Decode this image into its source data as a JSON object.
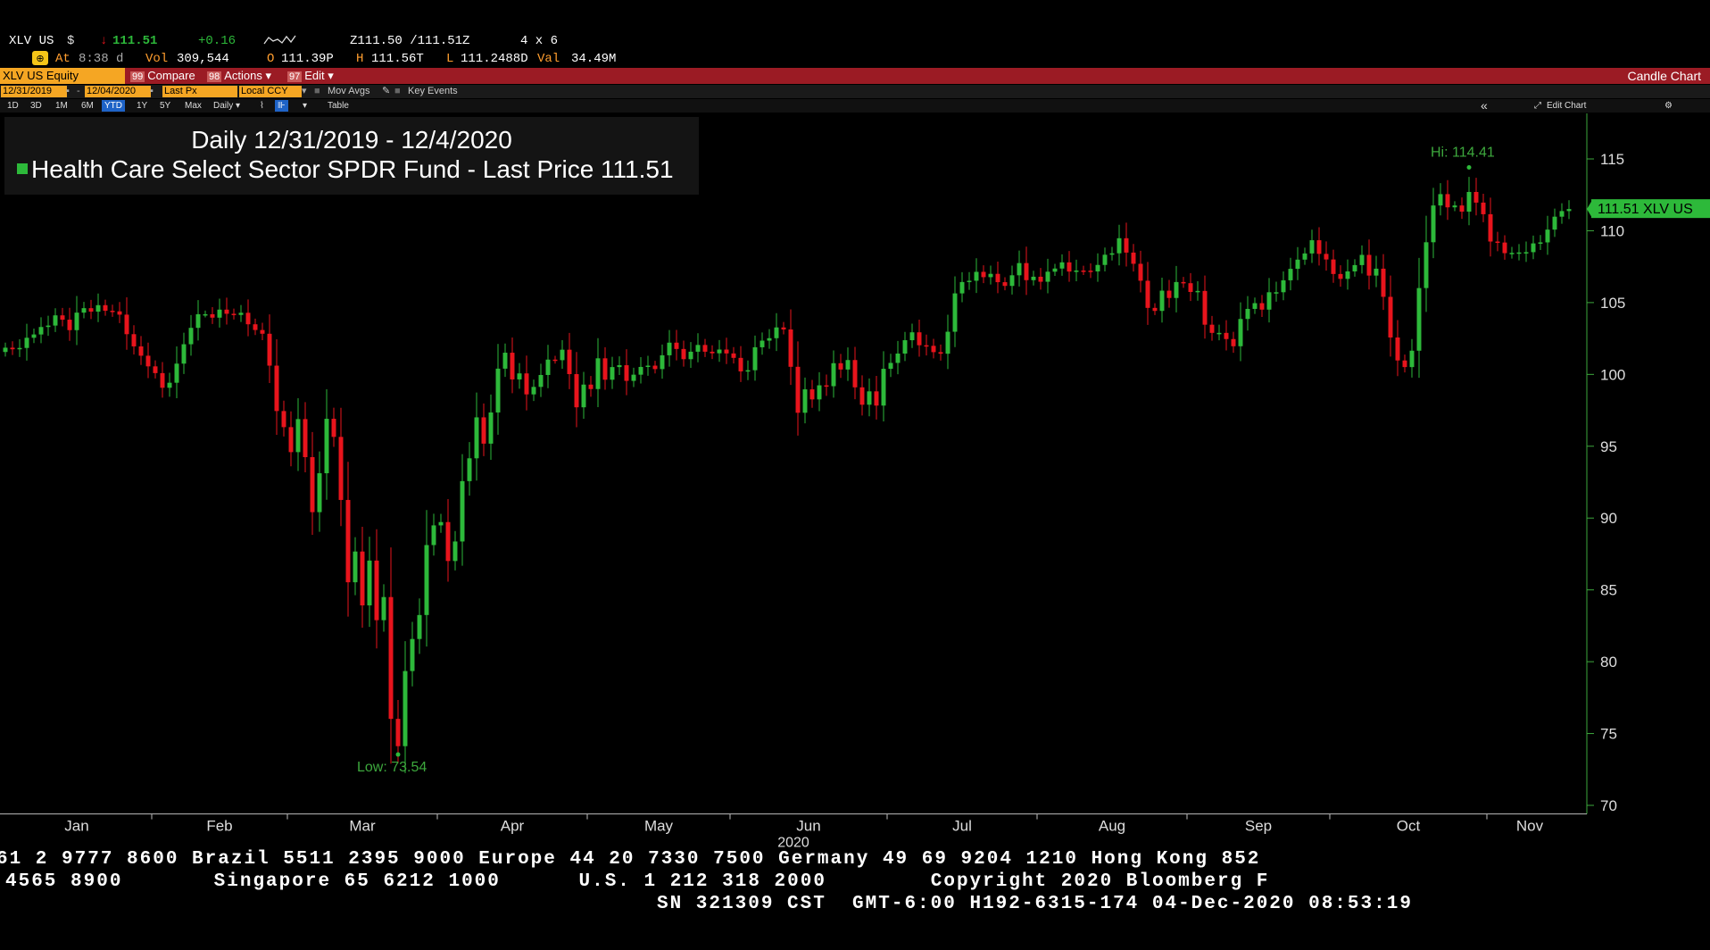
{
  "quote": {
    "ticker": "XLV US",
    "currency": "$",
    "arrow": "↓",
    "last": "111.51",
    "change": "+0.16",
    "bidask": "Z111.50 /111.51Z",
    "size": "4 x 6",
    "at_label": "At",
    "time": "8:38 d",
    "vol_label": "Vol",
    "vol": "309,544",
    "open_label": "O",
    "open": "111.39P",
    "high_label": "H",
    "high": "111.56T",
    "low_label": "L",
    "low": "111.2488D",
    "val_label": "Val",
    "val": "34.49M"
  },
  "toolbar": {
    "security": "XLV US Equity",
    "compare_num": "99",
    "compare": "Compare",
    "actions_num": "98",
    "actions": "Actions ▾",
    "edit_num": "97",
    "edit": "Edit ▾",
    "chart_type": "Candle Chart"
  },
  "datebar": {
    "start": "12/31/2019",
    "end": "12/04/2020",
    "field": "Last Px",
    "ccy": "Local CCY",
    "mov_avgs": "Mov Avgs",
    "key_events": "Key Events"
  },
  "ranges": [
    "1D",
    "3D",
    "1M",
    "6M",
    "YTD",
    "1Y",
    "5Y",
    "Max",
    "Daily ▾"
  ],
  "selected_range": "YTD",
  "table_label": "Table",
  "edit_chart": "Edit Chart",
  "legend": {
    "title": "Daily 12/31/2019 - 12/4/2020",
    "series": "Health Care Select Sector SPDR Fund - Last Price 111.51"
  },
  "colors": {
    "up": "#2db93a",
    "down": "#e8141c",
    "axis": "#3da83d",
    "price_tag": "#2db93a"
  },
  "chart_data": {
    "type": "candlestick",
    "x_labels": [
      "Jan",
      "Feb",
      "Mar",
      "Apr",
      "May",
      "Jun",
      "Jul",
      "Aug",
      "Sep",
      "Oct",
      "Nov"
    ],
    "x_year": "2020",
    "y_ticks": [
      70,
      75,
      80,
      85,
      90,
      95,
      100,
      105,
      110,
      115
    ],
    "ylim": [
      69.5,
      117.5
    ],
    "hi_label": "Hi: 114.41",
    "low_label": "Low: 73.54",
    "last_tag": "111.51 XLV US",
    "last": 111.51,
    "closes": [
      101.86,
      101.75,
      101.84,
      102.55,
      102.78,
      103.3,
      103.4,
      104.11,
      103.81,
      103.08,
      104.3,
      104.61,
      104.37,
      104.82,
      104.43,
      104.39,
      104.16,
      102.8,
      101.95,
      101.3,
      100.56,
      100.09,
      99.07,
      99.42,
      100.75,
      102.1,
      103.24,
      104.19,
      104.19,
      103.95,
      104.51,
      104.22,
      104.14,
      104.29,
      103.49,
      103.09,
      102.83,
      100.61,
      97.45,
      96.33,
      94.59,
      96.89,
      94.24,
      90.41,
      93.12,
      96.91,
      95.65,
      91.26,
      85.53,
      87.67,
      83.92,
      87.04,
      82.89,
      84.5,
      76.02,
      74.12,
      79.35,
      81.58,
      83.25,
      88.12,
      89.49,
      89.72,
      87.01,
      88.37,
      92.57,
      94.16,
      97.01,
      95.18,
      97.35,
      100.4,
      101.51,
      99.65,
      100.07,
      98.61,
      99.13,
      99.96,
      101.03,
      100.99,
      101.72,
      100.02,
      97.71,
      99.29,
      98.98,
      101.12,
      99.63,
      100.51,
      100.64,
      99.55,
      99.98,
      100.52,
      100.61,
      100.37,
      101.33,
      102.21,
      101.77,
      101.06,
      101.58,
      102.05,
      101.58,
      101.47,
      101.73,
      101.46,
      101.15,
      100.21,
      100.29,
      101.89,
      102.35,
      102.52,
      103.27,
      103.13,
      100.53,
      97.33,
      98.96,
      98.26,
      99.24,
      99.18,
      100.78,
      100.34,
      101.0,
      99.1,
      97.89,
      98.82,
      97.83,
      100.39,
      100.8,
      101.45,
      102.38,
      102.93,
      102.03,
      101.99,
      101.55,
      101.44,
      102.97,
      105.64,
      106.43,
      106.52,
      107.14,
      106.77,
      107.0,
      106.42,
      106.16,
      106.9,
      107.75,
      106.56,
      106.8,
      106.45,
      107.15,
      107.37,
      107.8,
      107.16,
      107.23,
      107.22,
      107.17,
      107.62,
      108.33,
      108.43,
      109.48,
      108.48,
      107.7,
      106.52,
      104.63,
      104.42,
      105.83,
      105.32,
      106.43,
      106.35,
      105.74,
      105.81,
      103.46,
      102.89,
      102.89,
      102.46,
      101.96,
      103.86,
      104.56,
      104.96,
      104.51,
      105.72,
      105.72,
      106.55,
      107.35,
      107.99,
      108.42,
      109.34,
      108.39,
      108.0,
      106.99,
      106.65,
      107.17,
      107.61,
      108.32,
      106.88,
      107.36,
      105.4,
      102.57,
      100.97,
      100.51,
      101.65,
      106.01,
      109.2,
      111.76,
      112.55,
      111.63,
      111.76,
      111.33,
      112.7,
      111.96,
      111.15,
      109.25,
      109.18,
      108.44,
      108.46,
      108.49,
      108.51,
      109.12,
      109.19,
      110.08,
      110.98,
      111.37,
      111.51
    ]
  },
  "footer": {
    "line1": "61 2 9777 8600 Brazil 5511 2395 9000 Europe 44 20 7330 7500 Germany 49 69 9204 1210 Hong Kong 852",
    "line2": "4565 8900       Singapore 65 6212 1000      U.S. 1 212 318 2000        Copyright 2020 Bloomberg F",
    "line3": "SN 321309 CST  GMT-6:00 H192-6315-174 04-Dec-2020 08:53:19"
  }
}
